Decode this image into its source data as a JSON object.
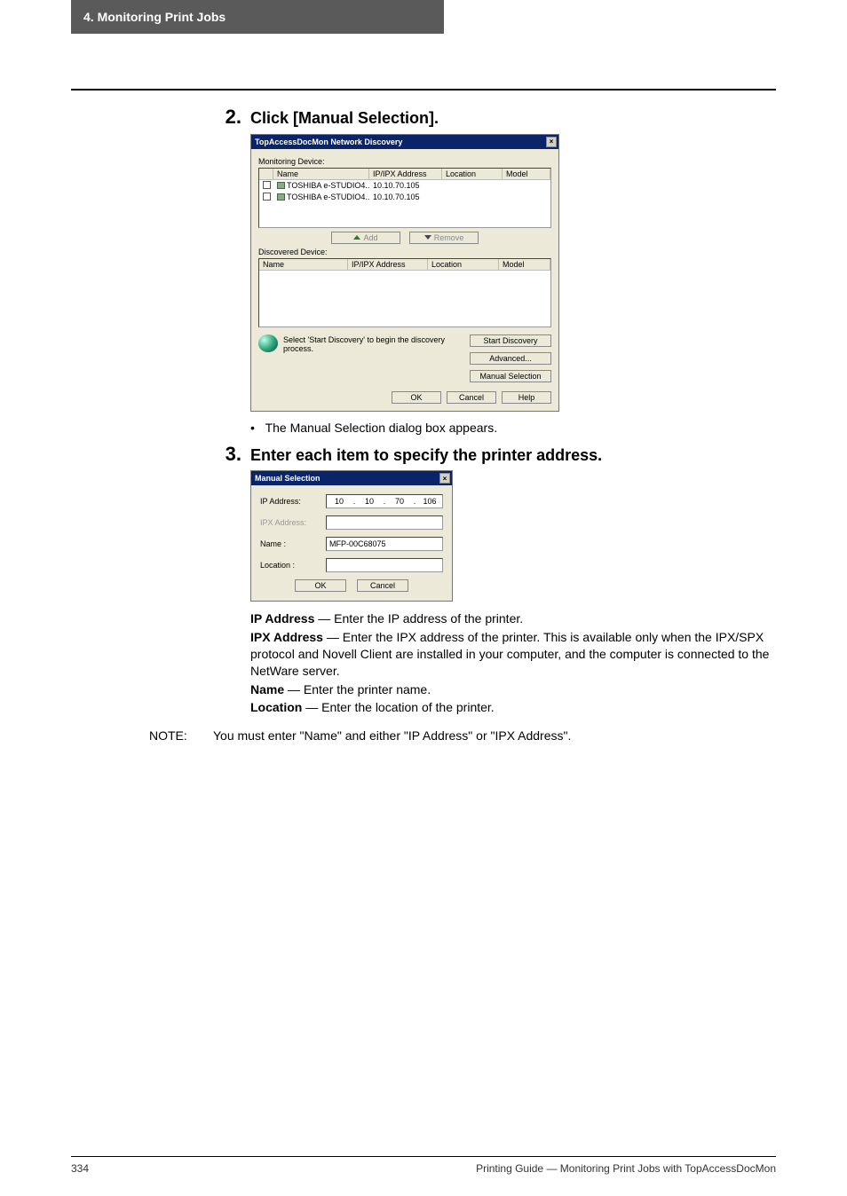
{
  "header": {
    "tab": "4. Monitoring Print Jobs"
  },
  "steps": {
    "s2": {
      "num": "2.",
      "text": "Click [Manual Selection]."
    },
    "s3": {
      "num": "3.",
      "text": "Enter each item to specify the printer address."
    }
  },
  "dialog1": {
    "title": "TopAccessDocMon Network Discovery",
    "label_monitoring": "Monitoring Device:",
    "cols": {
      "name": "Name",
      "ip": "IP/IPX Address",
      "loc": "Location",
      "model": "Model"
    },
    "rows": [
      {
        "name": "TOSHIBA e-STUDIO4...",
        "ip": "10.10.70.105"
      },
      {
        "name": "TOSHIBA e-STUDIO4...",
        "ip": "10.10.70.105"
      }
    ],
    "btn_add": "Add",
    "btn_remove": "Remove",
    "label_discovered": "Discovered Device:",
    "discovery_hint": "Select 'Start Discovery' to begin the discovery process.",
    "btn_start": "Start Discovery",
    "btn_advanced": "Advanced...",
    "btn_manual": "Manual Selection",
    "btn_ok": "OK",
    "btn_cancel": "Cancel",
    "btn_help": "Help"
  },
  "bullet_after_d1": "The Manual Selection dialog box appears.",
  "dialog2": {
    "title": "Manual Selection",
    "lbl_ip": "IP Address:",
    "ip": {
      "o1": "10",
      "o2": "10",
      "o3": "70",
      "o4": "106"
    },
    "lbl_ipx": "IPX Address:",
    "lbl_name": "Name :",
    "name_value": "MFP-00C68075",
    "lbl_location": "Location :",
    "btn_ok": "OK",
    "btn_cancel": "Cancel"
  },
  "desc": {
    "ip_bold": "IP Address",
    "ip_rest": " — Enter the IP address of the printer.",
    "ipx_bold": "IPX Address",
    "ipx_rest": " — Enter the IPX address of the printer.  This is available only when the IPX/SPX protocol and Novell Client are installed in your computer, and the computer is connected to the NetWare server.",
    "name_bold": "Name",
    "name_rest": " — Enter the printer name.",
    "loc_bold": "Location",
    "loc_rest": " — Enter the location of the printer."
  },
  "note": {
    "label": "NOTE:",
    "text": "You must enter \"Name\" and either \"IP Address\" or \"IPX Address\"."
  },
  "footer": {
    "page": "334",
    "right": "Printing Guide — Monitoring Print Jobs with TopAccessDocMon"
  }
}
